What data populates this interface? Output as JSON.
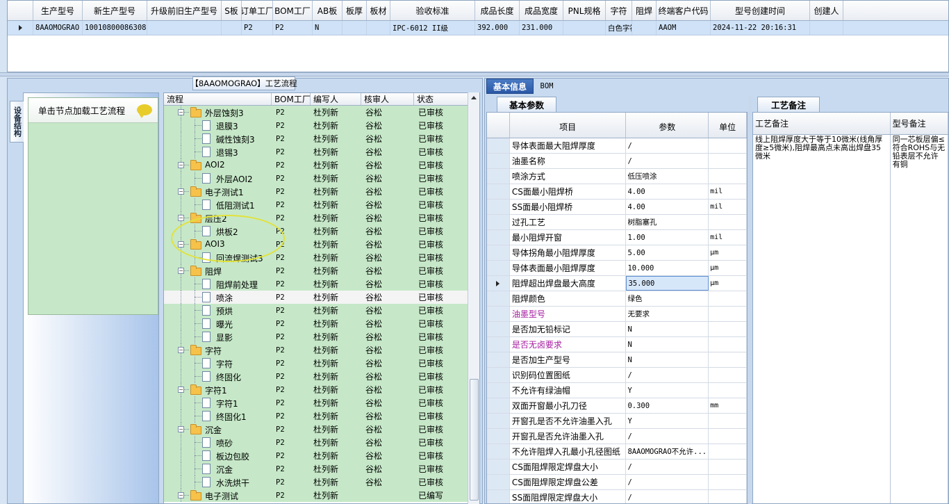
{
  "top_grid": {
    "columns": [
      "生产型号",
      "新生产型号",
      "升级前旧生产型号",
      "S板",
      "订单工厂",
      "BOM工厂",
      "AB板",
      "板厚",
      "板材",
      "验收标准",
      "成品长度",
      "成品宽度",
      "PNL规格",
      "字符",
      "阻焊",
      "终端客户代码",
      "型号创建时间",
      "创建人"
    ],
    "row": [
      "8AAOMOGRAO",
      "10010800086308",
      "",
      "",
      "P2",
      "P2",
      "N",
      "",
      "",
      "IPC-6012 II级",
      "392.000",
      "231.000",
      "",
      "白色字符",
      "",
      "AAOM",
      "2024-11-22 20:16:31",
      ""
    ]
  },
  "left_panel": {
    "side_tab": "设备结构",
    "nav_item": "单击节点加载工艺流程",
    "process_title": "【8AAOMOGRAO】工艺流程"
  },
  "process_grid": {
    "columns": [
      "流程",
      "BOM工厂",
      "编写人",
      "核审人",
      "状态"
    ],
    "rows": [
      {
        "name": "外层蚀刻3",
        "level": 0,
        "bom": "P2",
        "writer": "杜列新",
        "reviewer": "谷松",
        "status": "已审核"
      },
      {
        "name": "退膜3",
        "level": 1,
        "bom": "P2",
        "writer": "杜列新",
        "reviewer": "谷松",
        "status": "已审核"
      },
      {
        "name": "碱性蚀刻3",
        "level": 1,
        "bom": "P2",
        "writer": "杜列新",
        "reviewer": "谷松",
        "status": "已审核"
      },
      {
        "name": "退锡3",
        "level": 1,
        "bom": "P2",
        "writer": "杜列新",
        "reviewer": "谷松",
        "status": "已审核"
      },
      {
        "name": "AOI2",
        "level": 0,
        "bom": "P2",
        "writer": "杜列新",
        "reviewer": "谷松",
        "status": "已审核"
      },
      {
        "name": "外层AOI2",
        "level": 1,
        "bom": "P2",
        "writer": "杜列新",
        "reviewer": "谷松",
        "status": "已审核"
      },
      {
        "name": "电子测试1",
        "level": 0,
        "bom": "P2",
        "writer": "杜列新",
        "reviewer": "谷松",
        "status": "已审核"
      },
      {
        "name": "低阻测试1",
        "level": 1,
        "bom": "P2",
        "writer": "杜列新",
        "reviewer": "谷松",
        "status": "已审核"
      },
      {
        "name": "层压2",
        "level": 0,
        "bom": "P2",
        "writer": "杜列新",
        "reviewer": "谷松",
        "status": "已审核"
      },
      {
        "name": "烘板2",
        "level": 1,
        "bom": "P2",
        "writer": "杜列新",
        "reviewer": "谷松",
        "status": "已审核"
      },
      {
        "name": "AOI3",
        "level": 0,
        "bom": "P2",
        "writer": "杜列新",
        "reviewer": "谷松",
        "status": "已审核"
      },
      {
        "name": "回流焊测试3",
        "level": 1,
        "bom": "P2",
        "writer": "杜列新",
        "reviewer": "谷松",
        "status": "已审核"
      },
      {
        "name": "阻焊",
        "level": 0,
        "bom": "P2",
        "writer": "杜列新",
        "reviewer": "谷松",
        "status": "已审核"
      },
      {
        "name": "阻焊前处理",
        "level": 1,
        "bom": "P2",
        "writer": "杜列新",
        "reviewer": "谷松",
        "status": "已审核"
      },
      {
        "name": "喷涂",
        "level": 1,
        "bom": "P2",
        "writer": "杜列新",
        "reviewer": "谷松",
        "status": "已审核",
        "selected": true
      },
      {
        "name": "预烘",
        "level": 1,
        "bom": "P2",
        "writer": "杜列新",
        "reviewer": "谷松",
        "status": "已审核"
      },
      {
        "name": "曝光",
        "level": 1,
        "bom": "P2",
        "writer": "杜列新",
        "reviewer": "谷松",
        "status": "已审核"
      },
      {
        "name": "显影",
        "level": 1,
        "bom": "P2",
        "writer": "杜列新",
        "reviewer": "谷松",
        "status": "已审核"
      },
      {
        "name": "字符",
        "level": 0,
        "bom": "P2",
        "writer": "杜列新",
        "reviewer": "谷松",
        "status": "已审核"
      },
      {
        "name": "字符",
        "level": 1,
        "bom": "P2",
        "writer": "杜列新",
        "reviewer": "谷松",
        "status": "已审核"
      },
      {
        "name": "终固化",
        "level": 1,
        "bom": "P2",
        "writer": "杜列新",
        "reviewer": "谷松",
        "status": "已审核"
      },
      {
        "name": "字符1",
        "level": 0,
        "bom": "P2",
        "writer": "杜列新",
        "reviewer": "谷松",
        "status": "已审核"
      },
      {
        "name": "字符1",
        "level": 1,
        "bom": "P2",
        "writer": "杜列新",
        "reviewer": "谷松",
        "status": "已审核"
      },
      {
        "name": "终固化1",
        "level": 1,
        "bom": "P2",
        "writer": "杜列新",
        "reviewer": "谷松",
        "status": "已审核"
      },
      {
        "name": "沉金",
        "level": 0,
        "bom": "P2",
        "writer": "杜列新",
        "reviewer": "谷松",
        "status": "已审核"
      },
      {
        "name": "喷砂",
        "level": 1,
        "bom": "P2",
        "writer": "杜列新",
        "reviewer": "谷松",
        "status": "已审核"
      },
      {
        "name": "板边包胶",
        "level": 1,
        "bom": "P2",
        "writer": "杜列新",
        "reviewer": "谷松",
        "status": "已审核"
      },
      {
        "name": "沉金",
        "level": 1,
        "bom": "P2",
        "writer": "杜列新",
        "reviewer": "谷松",
        "status": "已审核"
      },
      {
        "name": "水洗烘干",
        "level": 1,
        "bom": "P2",
        "writer": "杜列新",
        "reviewer": "谷松",
        "status": "已审核"
      },
      {
        "name": "电子测试",
        "level": 0,
        "bom": "P2",
        "writer": "杜列新",
        "reviewer": "",
        "status": "已编写"
      }
    ]
  },
  "right_panel": {
    "tabs": [
      "基本信息",
      "BOM"
    ],
    "subtab": "基本参数",
    "remarks_tab": "工艺备注",
    "param_columns": [
      "项目",
      "参数",
      "单位"
    ],
    "params": [
      {
        "item": "导体表面最大阻焊厚度",
        "value": "/",
        "unit": ""
      },
      {
        "item": "油墨名称",
        "value": "/",
        "unit": ""
      },
      {
        "item": "喷涂方式",
        "value": "低压喷涂",
        "unit": ""
      },
      {
        "item": "CS面最小阻焊桥",
        "value": "4.00",
        "unit": "mil"
      },
      {
        "item": "SS面最小阻焊桥",
        "value": "4.00",
        "unit": "mil"
      },
      {
        "item": "过孔工艺",
        "value": "树脂塞孔",
        "unit": ""
      },
      {
        "item": "最小阻焊开窗",
        "value": "1.00",
        "unit": "mil"
      },
      {
        "item": "导体拐角最小阻焊厚度",
        "value": "5.00",
        "unit": "μm"
      },
      {
        "item": "导体表面最小阻焊厚度",
        "value": "10.000",
        "unit": "μm"
      },
      {
        "item": "阻焊超出焊盘最大高度",
        "value": "35.000",
        "unit": "μm",
        "current": true
      },
      {
        "item": "阻焊颜色",
        "value": "绿色",
        "unit": ""
      },
      {
        "item": "油墨型号",
        "value": "无要求",
        "unit": "",
        "purple": true
      },
      {
        "item": "是否加无铅标记",
        "value": "N",
        "unit": ""
      },
      {
        "item": "是否无卤要求",
        "value": "N",
        "unit": "",
        "purple": true
      },
      {
        "item": "是否加生产型号",
        "value": "N",
        "unit": ""
      },
      {
        "item": "识别码位置图纸",
        "value": "/",
        "unit": ""
      },
      {
        "item": "不允许有绿油帽",
        "value": "Y",
        "unit": ""
      },
      {
        "item": "双面开窗最小孔刀径",
        "value": "0.300",
        "unit": "mm"
      },
      {
        "item": "开窗孔是否不允许油墨入孔",
        "value": "Y",
        "unit": ""
      },
      {
        "item": "开窗孔是否允许油墨入孔",
        "value": "/",
        "unit": ""
      },
      {
        "item": "不允许阻焊入孔最小孔径图纸",
        "value": "8AAOMOGRAO不允许...",
        "unit": ""
      },
      {
        "item": "CS面阻焊限定焊盘大小",
        "value": "/",
        "unit": ""
      },
      {
        "item": "CS面阻焊限定焊盘公差",
        "value": "/",
        "unit": ""
      },
      {
        "item": "SS面阻焊限定焊盘大小",
        "value": "/",
        "unit": ""
      }
    ],
    "remarks_columns": [
      "工艺备注",
      "型号备注"
    ],
    "process_remark": "线上阻焊厚度大于等于10微米(线角厚度≥5微米),阻焊最高点未高出焊盘35微米",
    "model_remark": "同一芯板层偏≤符合ROHS与无铅表层不允许有铜"
  },
  "colors": {
    "row_green": "#c6e8c8",
    "tab_blue": "#2a58a6",
    "selection_blue": "#cfe2f7",
    "purple_text": "#a51ca0"
  }
}
